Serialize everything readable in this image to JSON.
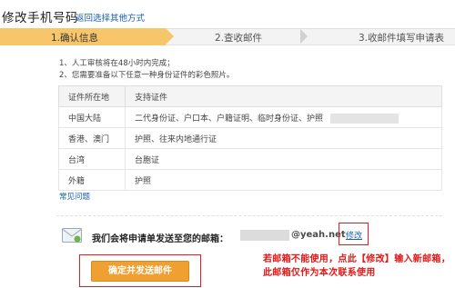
{
  "header": {
    "title": "修改手机号码",
    "alt_link": "返回选择其他方式"
  },
  "steps": [
    {
      "label": "1.确认信息",
      "active": true
    },
    {
      "label": "2.查收邮件",
      "active": false
    },
    {
      "label": "3.收邮件填写申请表",
      "active": false
    }
  ],
  "notes": [
    "1、人工审核将在48小时内完成；",
    "2、您需要准备以下任意一种身份证件的彩色照片。"
  ],
  "table": {
    "headers": [
      "证件所在地",
      "支持证件"
    ],
    "rows": [
      [
        "中国大陆",
        "二代身份证、户口本、户籍证明、临时身份证、护照"
      ],
      [
        "香港、澳门",
        "护照、往来内地通行证"
      ],
      [
        "台湾",
        "台胞证"
      ],
      [
        "外籍",
        "护照"
      ]
    ]
  },
  "faq_link": "常见问题",
  "send": {
    "text": "我们会将申请单发送至您的邮箱：",
    "email_domain": "@yeah.net",
    "modify_link": "修改",
    "button": "确定并发送邮件"
  },
  "annotation": "若邮箱不能使用，点此【修改】输入新邮箱，此邮箱仅作为本次联系使用",
  "colors": {
    "active_step": "#f7c66b",
    "button": "#f0a030",
    "link": "#1a5fb4",
    "annotation": "#e01818"
  }
}
